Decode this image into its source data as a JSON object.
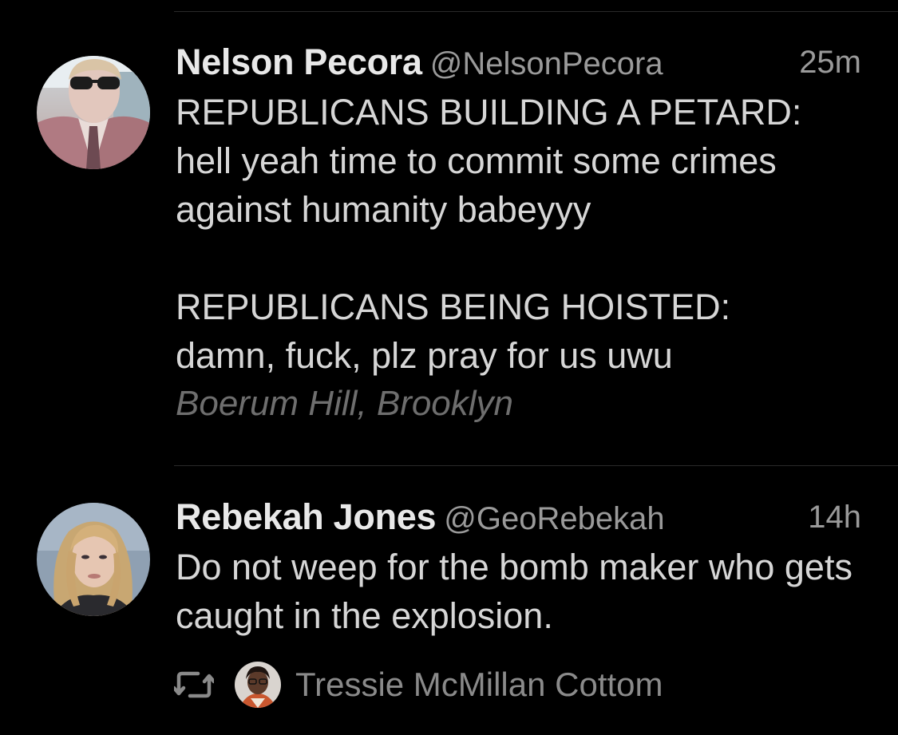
{
  "tweets": [
    {
      "name": "Nelson Pecora",
      "handle": "@NelsonPecora",
      "time": "25m",
      "text": "REPUBLICANS BUILDING A PETARD:\nhell yeah time to commit some crimes against humanity babeyyy\n\nREPUBLICANS BEING HOISTED:\ndamn, fuck, plz pray for us uwu",
      "location": "Boerum Hill, Brooklyn",
      "avatar_icon": "person-with-sunglasses-avatar"
    },
    {
      "name": "Rebekah Jones",
      "handle": "@GeoRebekah",
      "time": "14h",
      "text": "Do not weep for the bomb maker who gets caught in the explosion.",
      "avatar_icon": "person-blonde-avatar",
      "retweet": {
        "icon": "retweet-icon",
        "by": "Tressie McMillan Cottom",
        "avatar_icon": "person-with-glasses-avatar"
      }
    }
  ],
  "colors": {
    "background": "#000000",
    "primary_text": "#e8e8e8",
    "secondary_text": "#9a9a9a",
    "location_text": "#6e6e6e",
    "divider": "#2a2a2a"
  }
}
